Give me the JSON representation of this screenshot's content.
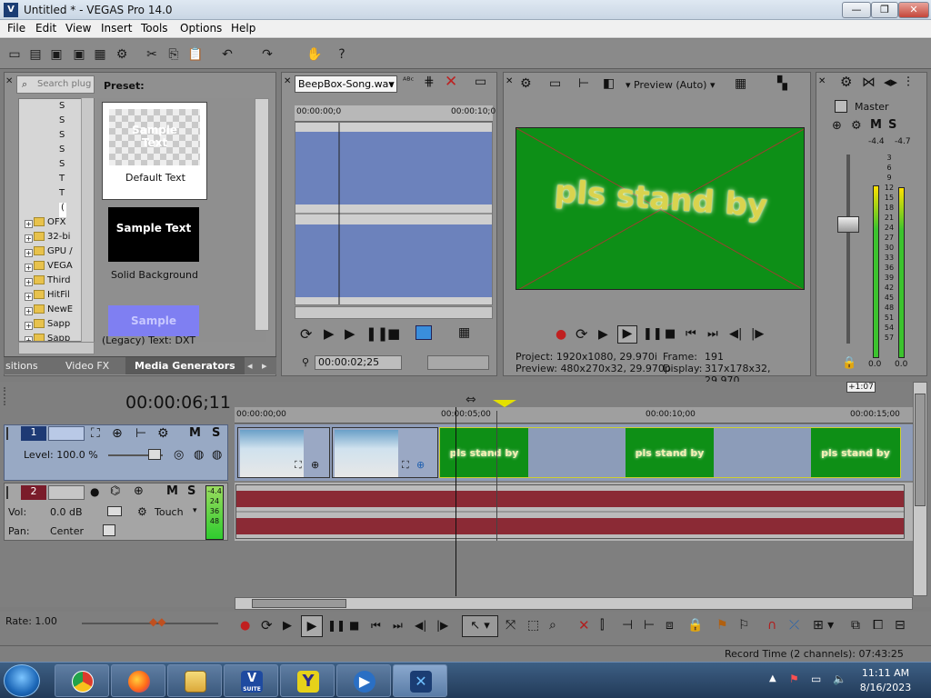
{
  "window": {
    "title": "Untitled * - VEGAS Pro 14.0",
    "minimize": "—",
    "maximize": "❐",
    "close": "✕",
    "app_icon": "V"
  },
  "menu": [
    "File",
    "Edit",
    "View",
    "Insert",
    "Tools",
    "Options",
    "Help"
  ],
  "explorer": {
    "search_placeholder": "Search plug",
    "preset_label": "Preset:",
    "tree_items": [
      "S",
      "S",
      "S",
      "S",
      "S",
      "T",
      "T",
      "(",
      "OFX",
      "32-bi",
      "GPU /",
      "VEGA",
      "Third",
      "HitFil",
      "NewE",
      "Sapp",
      "Sapp"
    ],
    "presets": [
      {
        "sample": "Sample\nText",
        "caption": "Default Text"
      },
      {
        "sample": "Sample Text",
        "caption": "Solid Background"
      },
      {
        "sample": "Sample",
        "caption": ""
      }
    ],
    "legacy_label": "(Legacy) Text: DXT",
    "tabs": [
      "sitions",
      "Video FX",
      "Media Generators"
    ]
  },
  "trimmer": {
    "file": "BeepBox-Song.wav",
    "ruler_start": "00:00:00;0",
    "ruler_end": "00:00:10;0",
    "timecode": "00:00:02;25"
  },
  "preview": {
    "mode": "Preview (Auto)",
    "video_text": "pls stand by",
    "project_label": "Project:",
    "project_value": "1920x1080, 29.970i",
    "frame_label": "Frame:",
    "frame_value": "191",
    "preview_label": "Preview:",
    "preview_value": "480x270x32, 29.970p",
    "display_label": "Display:",
    "display_value": "317x178x32, 29.970"
  },
  "master": {
    "label": "Master",
    "peak_left": "-4.4",
    "peak_right": "-4.7",
    "scale": [
      "3",
      "6",
      "9",
      "12",
      "15",
      "18",
      "21",
      "24",
      "27",
      "30",
      "33",
      "36",
      "39",
      "42",
      "45",
      "48",
      "51",
      "54",
      "57"
    ],
    "level_left": "0.0",
    "level_right": "0.0"
  },
  "timeline": {
    "time_display": "00:00:06;11",
    "zoom": "+1:07",
    "ruler": [
      "00:00:00;00",
      "00:00:05;00",
      "00:00:10;00",
      "00:00:15;00"
    ],
    "track1": {
      "number": "1",
      "level": "Level: 100.0 %"
    },
    "track2": {
      "number": "2",
      "vol": "Vol:",
      "vol_value": "0.0 dB",
      "pan": "Pan:",
      "pan_value": "Center",
      "touch": "Touch",
      "meter_top": "-4.4",
      "meter_vals": [
        "24",
        "36",
        "48"
      ]
    },
    "clip_text": "pls stand by"
  },
  "transport": {
    "rate": "Rate: 1.00"
  },
  "status": {
    "record_time": "Record Time (2 channels): 07:43:25"
  },
  "taskbar": {
    "time": "11:11 AM",
    "date": "8/16/2023",
    "apps": [
      "chrome",
      "firefox",
      "files",
      "vegas-suite",
      "y-app",
      "media-player",
      "vegas-pro"
    ],
    "suite_label": "SUITE",
    "vegas_letter": "V"
  },
  "colors": {
    "green_video": "#0e8f16",
    "track_video": "#98a9c4",
    "waveform": "#8b2a35",
    "wave_blue": "#5b74b8"
  }
}
